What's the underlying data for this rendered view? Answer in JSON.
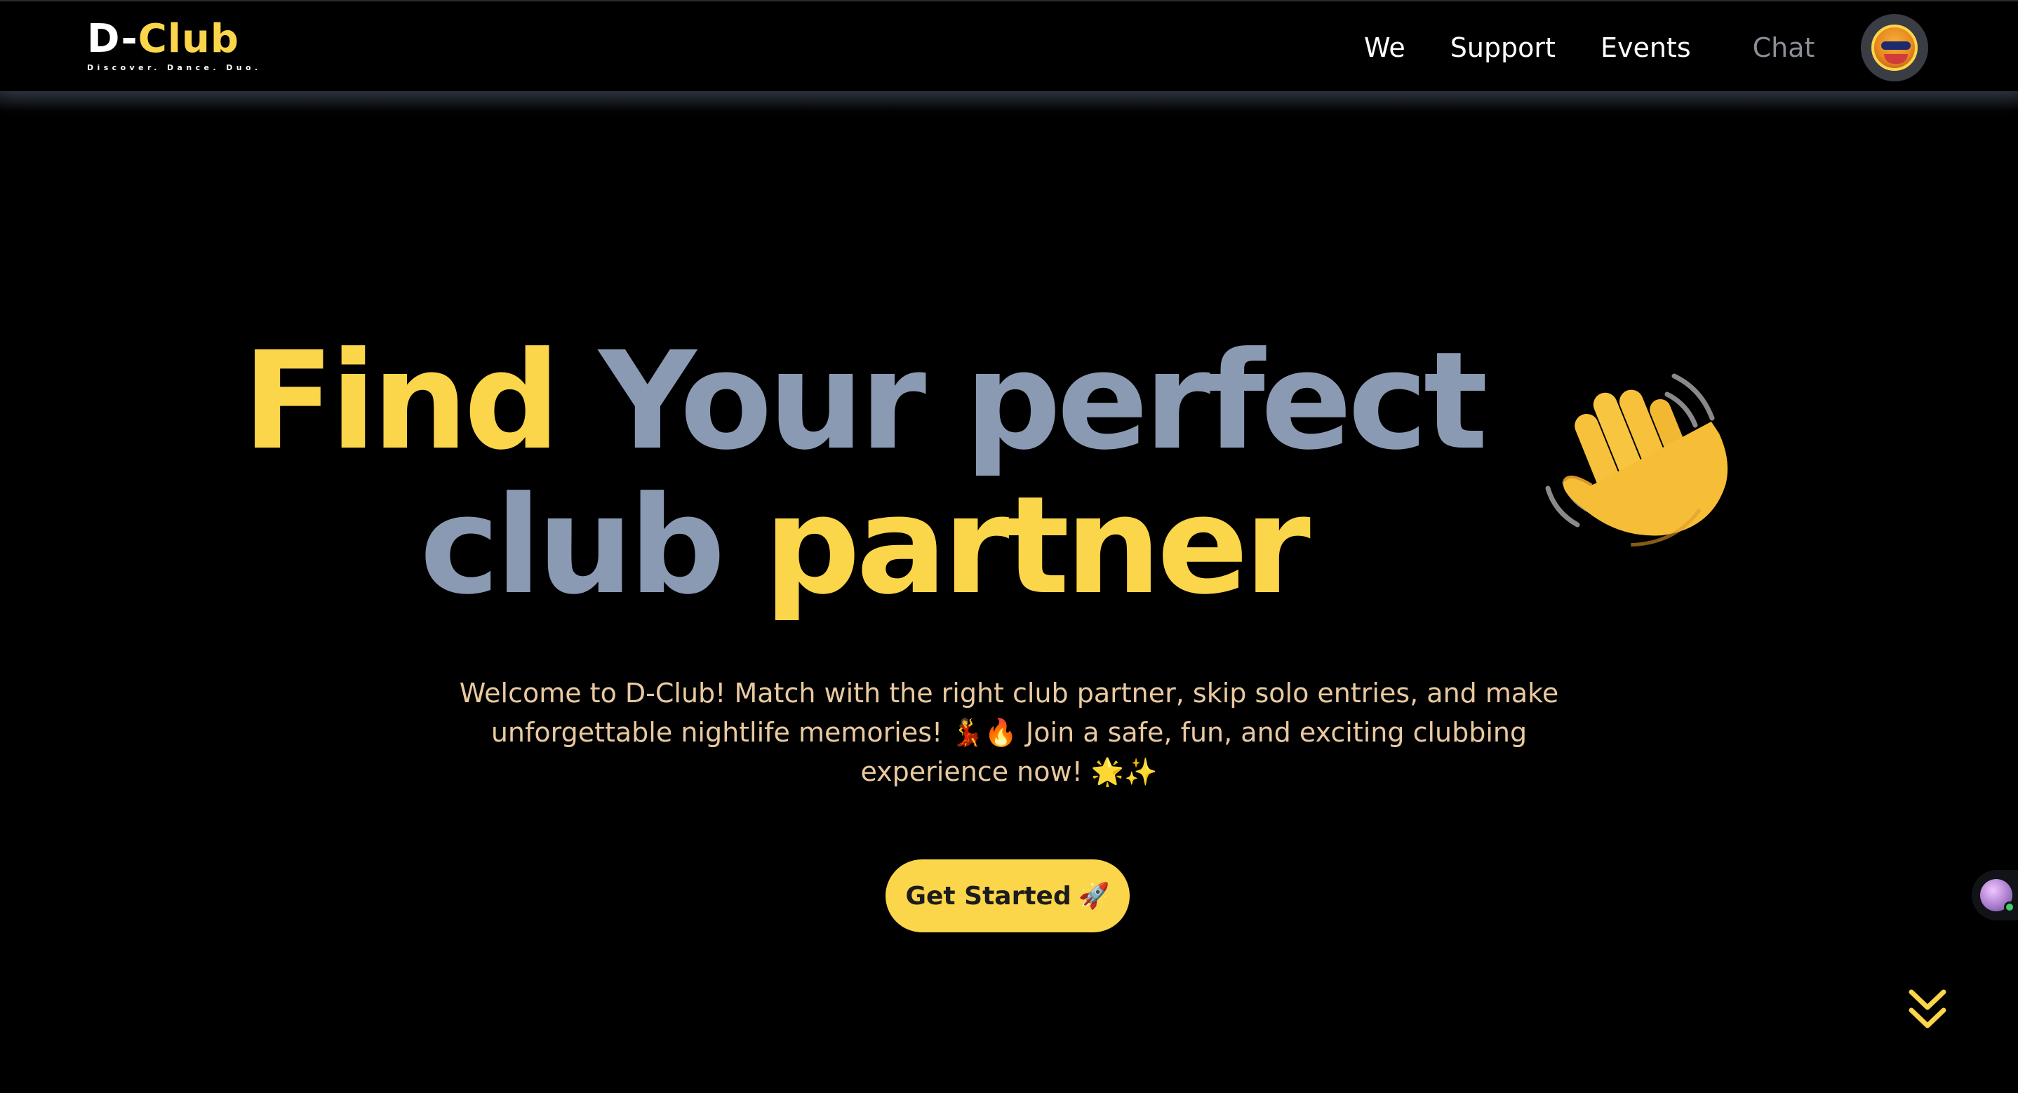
{
  "brand": {
    "logo_prefix": "D-",
    "logo_suffix": "Club",
    "tagline": "Discover. Dance. Duo."
  },
  "nav": {
    "items": [
      {
        "label": "We"
      },
      {
        "label": "Support"
      },
      {
        "label": "Events"
      },
      {
        "label": "Chat",
        "state": "muted"
      }
    ],
    "avatar_icon": "user-avatar-icon"
  },
  "hero": {
    "line1": {
      "word1": "Find",
      "word2": "Your perfect"
    },
    "line2": {
      "word1": "club",
      "word2": "partner"
    },
    "emoji_icon": "waving-hand-icon",
    "description": "Welcome to D-Club! Match with the right club partner, skip solo entries, and make unforgettable nightlife memories! 💃🔥 Join a safe, fun, and exciting clubbing experience now! 🌟✨",
    "cta_label": "Get Started",
    "cta_emoji": "🚀"
  },
  "widgets": {
    "chat_assistant_icon": "assistant-avatar-icon",
    "scroll_icon": "chevron-double-down-icon"
  },
  "colors": {
    "background": "#000000",
    "accent_yellow": "#fbd54a",
    "slate": "#8b9ab3",
    "description_text": "#e9c9a0",
    "nav_muted": "#8a8e96"
  }
}
